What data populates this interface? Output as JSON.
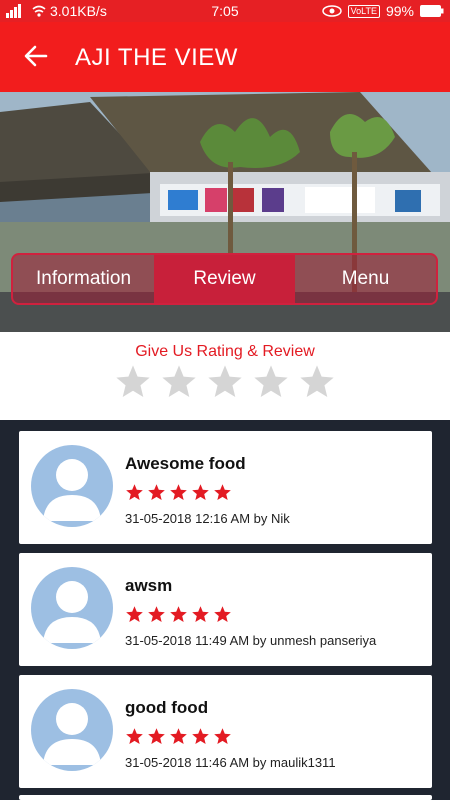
{
  "status": {
    "net_speed": "3.01KB/s",
    "time": "7:05",
    "volte": "VoLTE",
    "battery": "99%",
    "icons": [
      "signal-icon",
      "wifi-icon",
      "eye-icon",
      "battery-icon"
    ]
  },
  "appbar": {
    "title": "AJI THE VIEW",
    "back_icon": "back-arrow-icon"
  },
  "tabs": [
    {
      "label": "Information",
      "active": false
    },
    {
      "label": "Review",
      "active": true
    },
    {
      "label": "Menu",
      "active": false
    }
  ],
  "rating": {
    "title": "Give Us Rating & Review",
    "value": 0,
    "max": 5
  },
  "reviews": [
    {
      "title": "Awesome food",
      "stars": 5,
      "meta": "31-05-2018 12:16 AM by Nik"
    },
    {
      "title": "awsm",
      "stars": 5,
      "meta": "31-05-2018 11:49 AM by unmesh panseriya"
    },
    {
      "title": "good food",
      "stars": 5,
      "meta": "31-05-2018 11:46 AM by maulik1311"
    }
  ],
  "colors": {
    "primary": "#f21d1d",
    "accent": "#e31b23",
    "tab_active": "#c8203a",
    "background": "#1f2530",
    "avatar": "#9dbfe3"
  }
}
